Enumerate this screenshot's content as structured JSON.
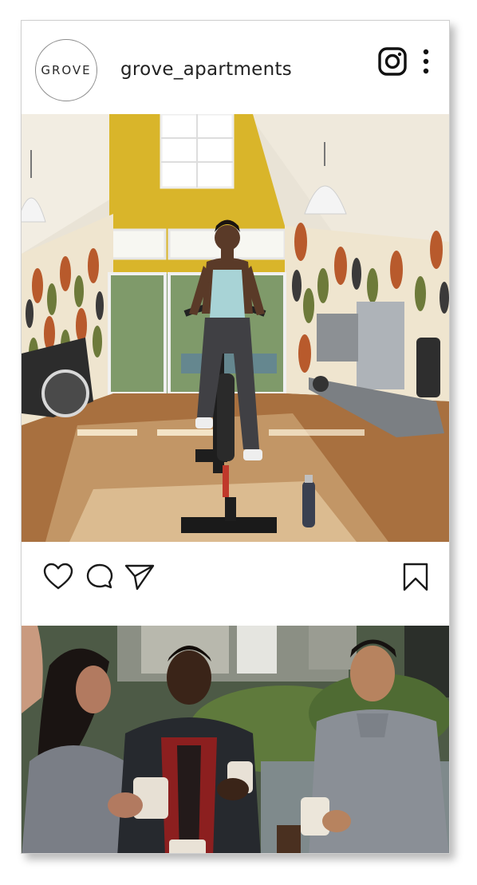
{
  "post": {
    "avatar_text": "GROVE",
    "username": "grove_apartments"
  },
  "icons": {
    "app": "instagram-icon",
    "menu": "more-vertical-icon",
    "like": "heart-icon",
    "comment": "comment-icon",
    "share": "send-icon",
    "save": "bookmark-icon"
  },
  "colors": {
    "text": "#222222",
    "card_border": "#cfcfcf",
    "icon": "#1a1a1a"
  }
}
